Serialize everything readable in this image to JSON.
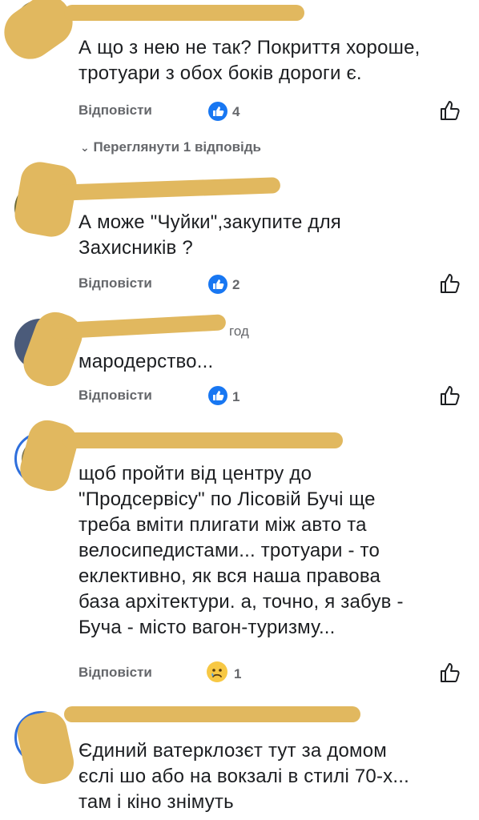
{
  "comments": [
    {
      "text": "А що з нею не так? Покриття хороше,\nтротуари з обох боків дороги є.",
      "reply_label": "Відповісти",
      "reaction_count": "4",
      "view_replies_label": "Переглянути 1 відповідь"
    },
    {
      "text": "А може \"Чуйки\",закупите для\nЗахисників ?",
      "reply_label": "Відповісти",
      "reaction_count": "2"
    },
    {
      "timestamp": "год",
      "text": "мародерство...",
      "reply_label": "Відповісти",
      "reaction_count": "1"
    },
    {
      "text": "щоб пройти від центру до\n\"Продсервісу\" по Лісовій Бучі ще\nтреба вміти плигати між авто та\nвелосипедистами...  тротуари - то\nеклективно, як вся наша правова\nбаза архітектури. а, точно, я забув -\nБуча - місто вагон-туризму...",
      "reply_label": "Відповісти",
      "reaction_count": "1"
    },
    {
      "text": "Єдиний ватерклозєт тут за домом\nєслі шо або на вокзалі в стилі 70-х...\nтам і кіно знімуть"
    }
  ],
  "icons": {
    "reaction": "like-reaction-icon",
    "sad": "sad-reaction-icon",
    "like": "thumbs-up-icon",
    "chevron": "chevron-down-icon"
  },
  "colors": {
    "redaction": "#e1b85f",
    "like_blue": "#1877f2",
    "secondary_text": "#65676b"
  }
}
